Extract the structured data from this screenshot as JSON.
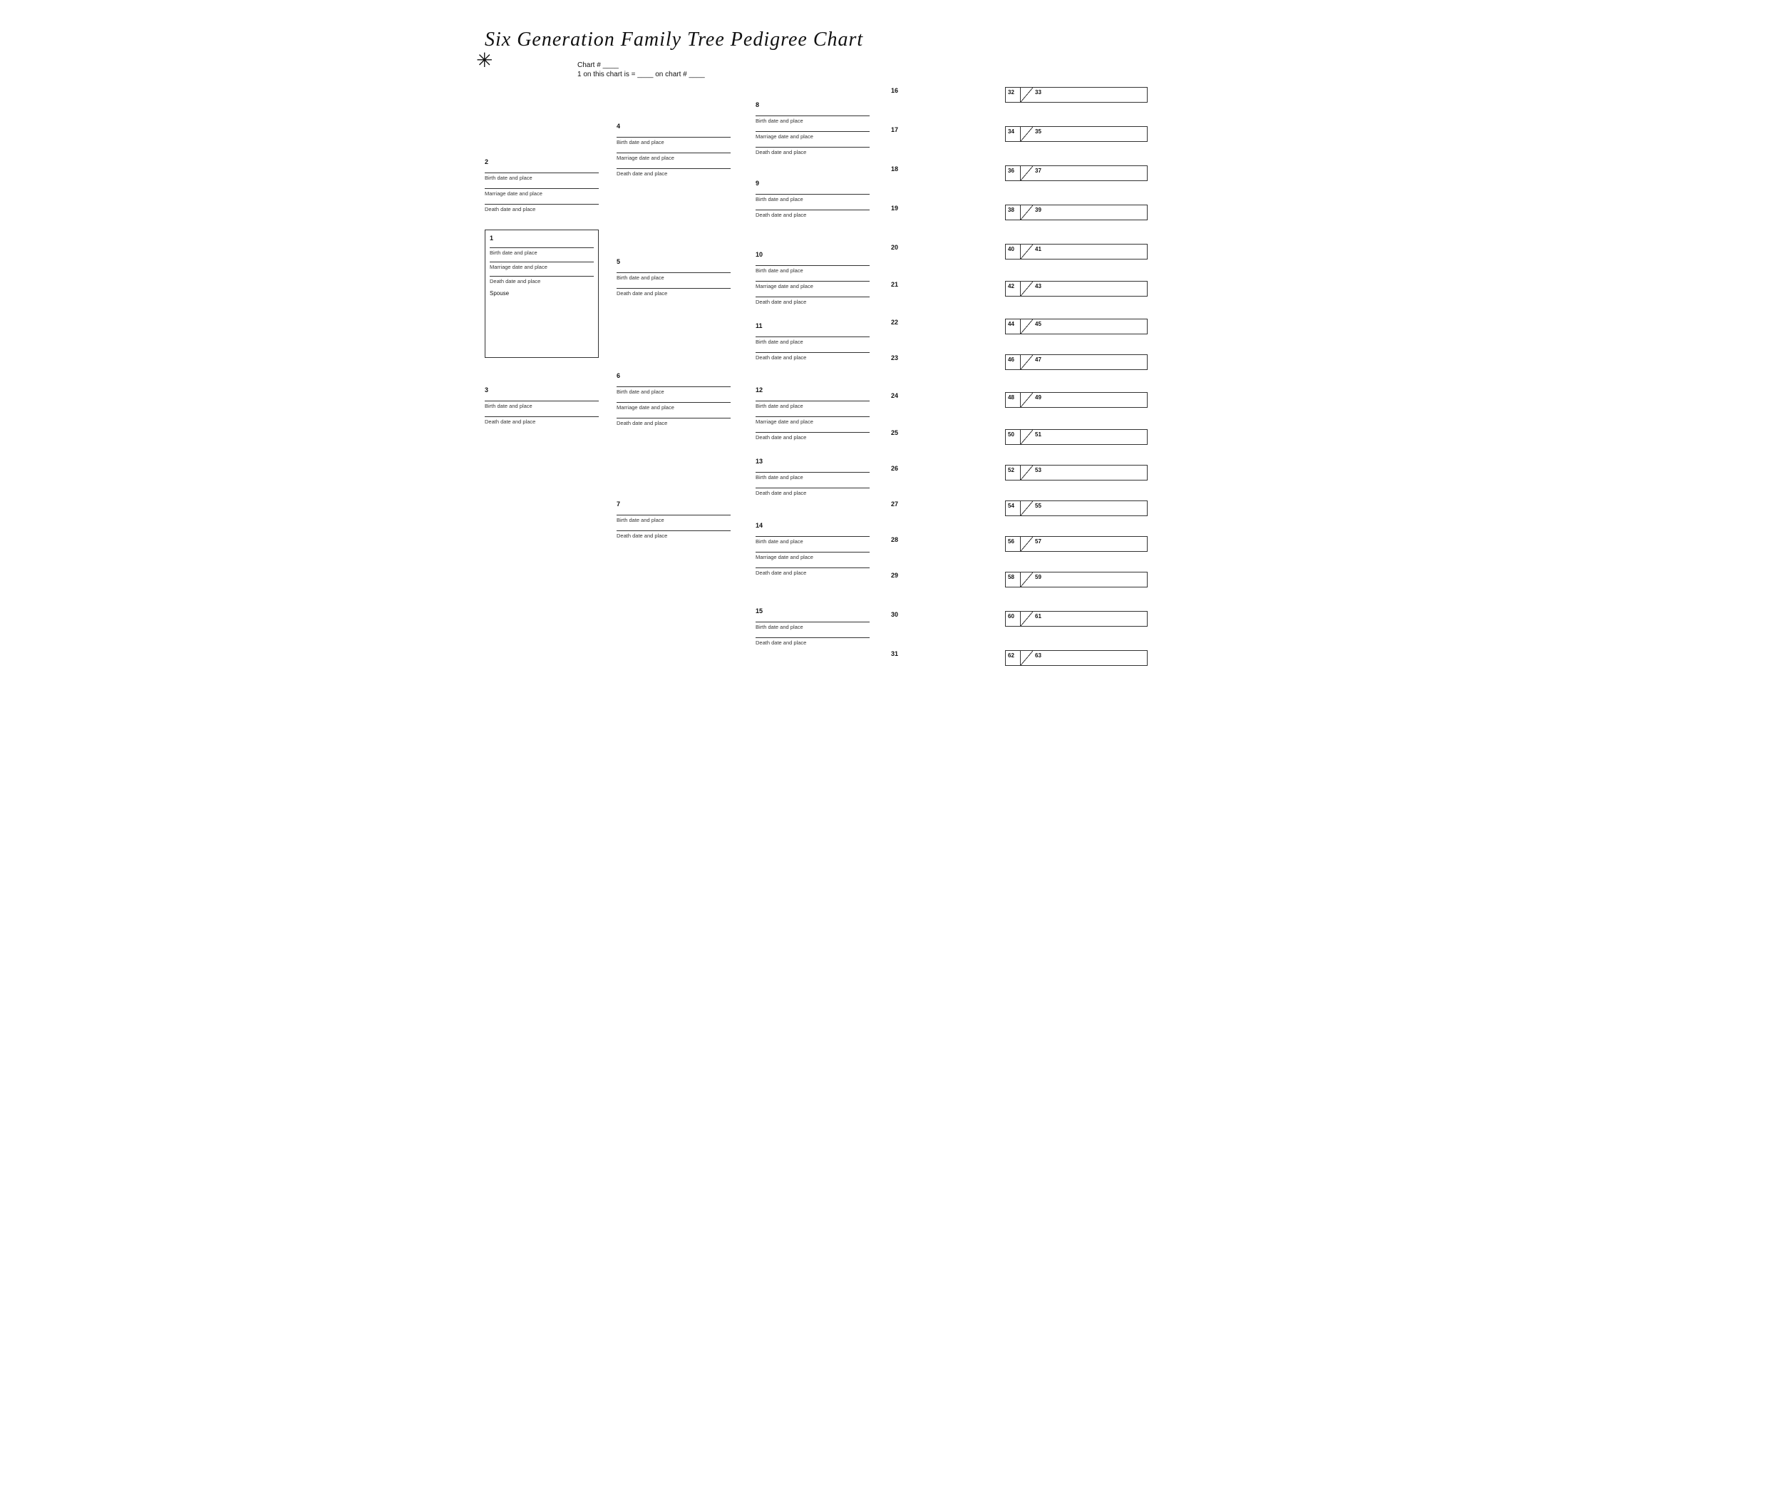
{
  "title": "Six Generation Family Tree Pedigree Chart",
  "chart_meta": {
    "chart_num_label": "Chart #",
    "chart_num_value": "____",
    "ref_label": "1 on this chart is = ____ on chart # ____"
  },
  "labels": {
    "birth": "Birth date and place",
    "marriage": "Marriage date and place",
    "death": "Death date and place",
    "spouse": "Spouse"
  },
  "persons": {
    "1": "1",
    "2": "2",
    "3": "3",
    "4": "4",
    "5": "5",
    "6": "6",
    "7": "7",
    "8": "8",
    "9": "9",
    "10": "10",
    "11": "11",
    "12": "12",
    "13": "13",
    "14": "14",
    "15": "15",
    "16": "16",
    "17": "17",
    "18": "18",
    "19": "19",
    "20": "20",
    "21": "21",
    "22": "22",
    "23": "23",
    "24": "24",
    "25": "25",
    "26": "26",
    "27": "27",
    "28": "28",
    "29": "29",
    "30": "30",
    "31": "31",
    "32": "32",
    "33": "33",
    "34": "34",
    "35": "35",
    "36": "36",
    "37": "37",
    "38": "38",
    "39": "39",
    "40": "40",
    "41": "41",
    "42": "42",
    "43": "43",
    "44": "44",
    "45": "45",
    "46": "46",
    "47": "47",
    "48": "48",
    "49": "49",
    "50": "50",
    "51": "51",
    "52": "52",
    "53": "53",
    "54": "54",
    "55": "55",
    "56": "56",
    "57": "57",
    "58": "58",
    "59": "59",
    "60": "60",
    "61": "61",
    "62": "62",
    "63": "63"
  }
}
